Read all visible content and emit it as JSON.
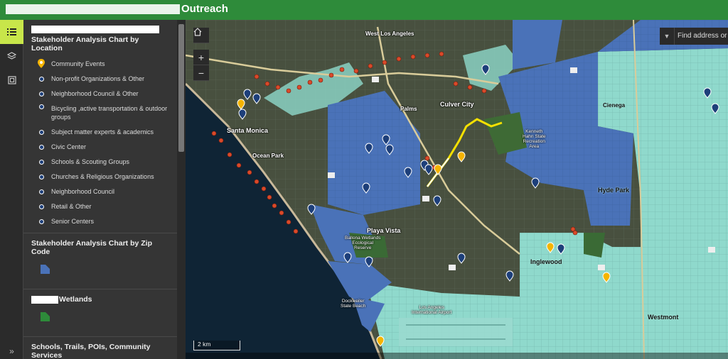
{
  "header": {
    "title": "Outreach"
  },
  "sidebar": {
    "sections": [
      {
        "title": "Stakeholder Analysis Chart by Location",
        "items": [
          {
            "label": "Community Events",
            "symbol": "pin-icon",
            "color": "#f5b400"
          },
          {
            "label": "Non-profit Organizations & Other",
            "symbol": "dot-icon",
            "color": "#1d3f7a"
          },
          {
            "label": "Neighborhood Council & Other",
            "symbol": "dot-icon",
            "color": "#1d3f7a"
          },
          {
            "label": "Bicycling ,active transportation & outdoor groups",
            "symbol": "dot-icon",
            "color": "#1d3f7a"
          },
          {
            "label": "Subject matter experts & academics",
            "symbol": "dot-icon",
            "color": "#1d3f7a"
          },
          {
            "label": "Civic Center",
            "symbol": "dot-icon",
            "color": "#1d3f7a"
          },
          {
            "label": "Schools & Scouting Groups",
            "symbol": "dot-icon",
            "color": "#1d3f7a"
          },
          {
            "label": "Churches & Religious Organizations",
            "symbol": "dot-icon",
            "color": "#1d3f7a"
          },
          {
            "label": "Neighborhood Council",
            "symbol": "dot-icon",
            "color": "#1d3f7a"
          },
          {
            "label": "Retail & Other",
            "symbol": "dot-icon",
            "color": "#1d3f7a"
          },
          {
            "label": "Senior Centers",
            "symbol": "dot-icon",
            "color": "#1d3f7a"
          }
        ]
      },
      {
        "title": "Stakeholder Analysis Chart by Zip Code",
        "swatch": "#4a72b8"
      },
      {
        "title": "Wetlands",
        "swatch": "#2e8b3a"
      },
      {
        "title": "Schools, Trails, POIs, Community Services"
      }
    ]
  },
  "map": {
    "search_placeholder": "Find address or place",
    "scale_label": "2 km",
    "home_icon": "home-icon",
    "zoom_in": "+",
    "zoom_out": "−",
    "labels": {
      "west_los_angeles": "West Los\nAngeles",
      "culver_city": "Culver City",
      "palms": "Palms",
      "santa_monica": "Santa Monica",
      "ocean_park": "Ocean Park",
      "playa_vista": "Playa Vista",
      "ballona": "Ballona Wetlands\nEcological\nReserve",
      "kenneth_hahn": "Kenneth\nHahn State\nRecreation\nArea",
      "cienega": "Cienega",
      "hyde_park": "Hyde Park",
      "inglewood": "Inglewood",
      "westmont": "Westmont",
      "lax": "Los Angeles\nInternational Airport",
      "dockweiler": "Dockweiler\nState Beach"
    }
  },
  "colors": {
    "header": "#2e8b3a",
    "accent": "#c8e64a",
    "zip_blue": "#4a72b8",
    "teal": "#8fd9cc",
    "community": "#f5b400",
    "trail": "#f5e000",
    "coast": "#d94a2a"
  }
}
